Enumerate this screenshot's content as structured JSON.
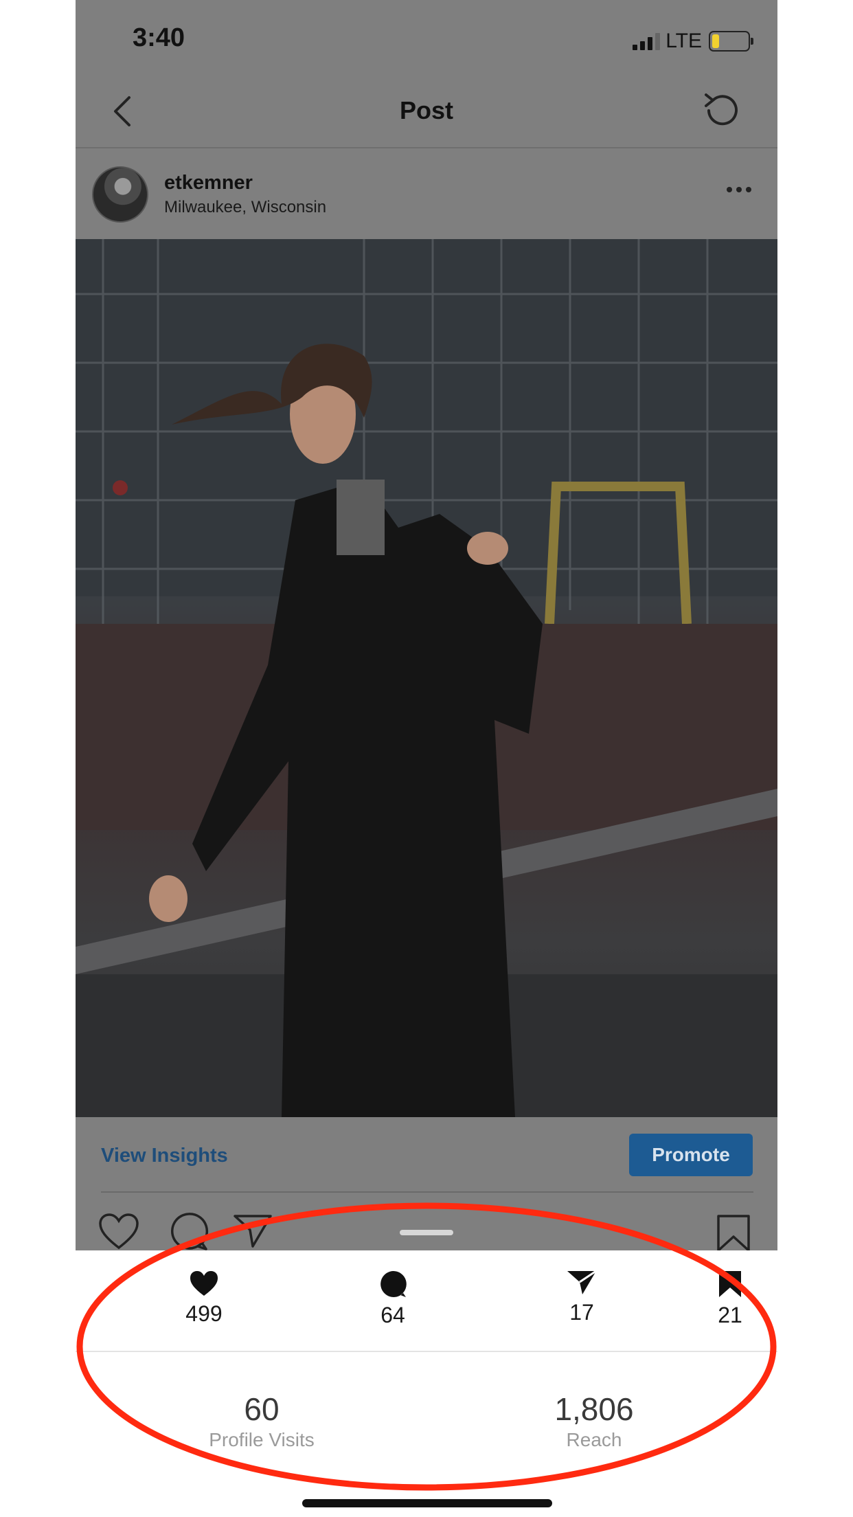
{
  "status_bar": {
    "time": "3:40",
    "network": "LTE"
  },
  "nav": {
    "title": "Post"
  },
  "post": {
    "username": "etkemner",
    "location": "Milwaukee, Wisconsin"
  },
  "insights_row": {
    "view_insights_label": "View Insights",
    "promote_label": "Promote"
  },
  "metrics": {
    "likes": "499",
    "comments": "64",
    "shares": "17",
    "saves": "21"
  },
  "stats": {
    "profile_visits": {
      "value": "60",
      "label": "Profile Visits"
    },
    "reach": {
      "value": "1,806",
      "label": "Reach"
    }
  },
  "colors": {
    "accent": "#1d5b93",
    "dim_overlay": "#7f7f7f",
    "annotation": "#ff2a10",
    "battery_low": "#f2d230"
  },
  "icons": [
    "back-icon",
    "refresh-icon",
    "more-icon",
    "heart-icon",
    "comment-icon",
    "share-icon",
    "bookmark-icon"
  ]
}
